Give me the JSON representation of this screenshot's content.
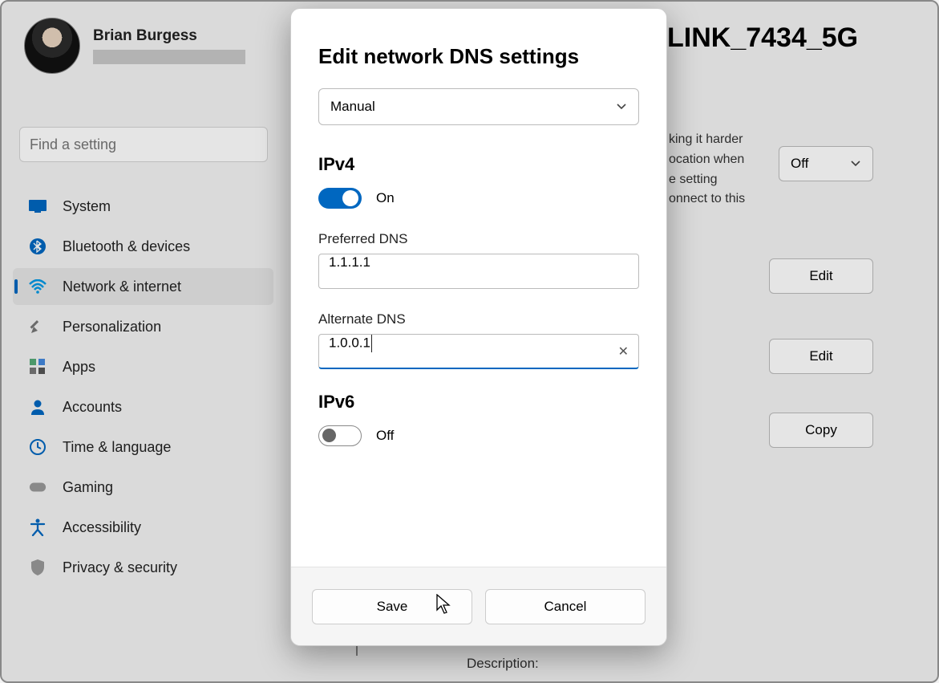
{
  "user": {
    "name": "Brian Burgess"
  },
  "search": {
    "placeholder": "Find a setting"
  },
  "sidebar": {
    "items": [
      {
        "label": "System"
      },
      {
        "label": "Bluetooth & devices"
      },
      {
        "label": "Network & internet"
      },
      {
        "label": "Personalization"
      },
      {
        "label": "Apps"
      },
      {
        "label": "Accounts"
      },
      {
        "label": "Time & language"
      },
      {
        "label": "Gaming"
      },
      {
        "label": "Accessibility"
      },
      {
        "label": "Privacy & security"
      }
    ]
  },
  "page": {
    "title_fragment": "LINK_7434_5G",
    "random_addresses_info": "king it harder\nocation when\ne setting\nonnect to this",
    "random_addresses_dropdown": "Off",
    "row_actions": {
      "edit": "Edit",
      "copy": "Copy"
    },
    "description_label": "Description:"
  },
  "dialog": {
    "title": "Edit network DNS settings",
    "mode_select": "Manual",
    "ipv4": {
      "section_title": "IPv4",
      "enabled": true,
      "toggle_label": "On",
      "preferred_label": "Preferred DNS",
      "preferred_value": "1.1.1.1",
      "alternate_label": "Alternate DNS",
      "alternate_value": "1.0.0.1"
    },
    "ipv6": {
      "section_title": "IPv6",
      "enabled": false,
      "toggle_label": "Off"
    },
    "buttons": {
      "save": "Save",
      "cancel": "Cancel"
    }
  }
}
